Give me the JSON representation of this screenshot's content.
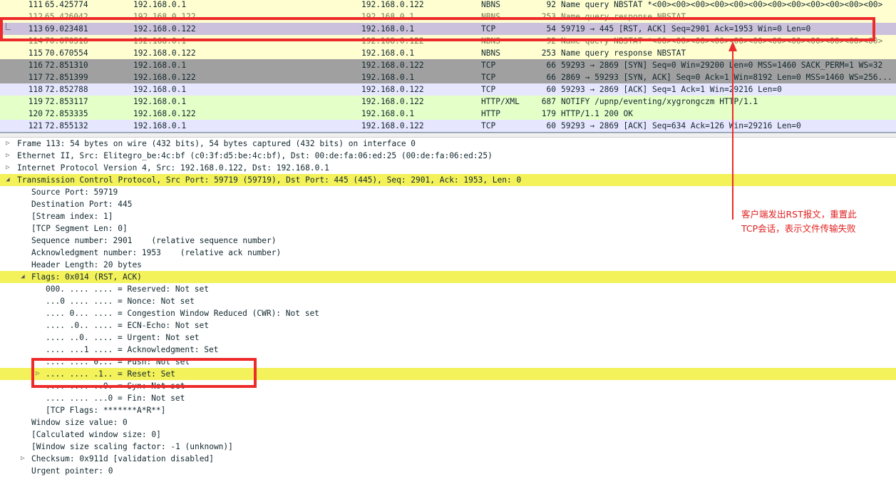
{
  "packet_list": {
    "rows": [
      {
        "no": "111",
        "time": "65.425774",
        "src": "192.168.0.1",
        "dst": "192.168.0.122",
        "proto": "NBNS",
        "len": "92",
        "info": "Name query NBSTAT *<00><00><00><00><00><00><00><00><00><00><00><00>"
      },
      {
        "no": "112",
        "time": "65.426042",
        "src": "192.168.0.122",
        "dst": "192.168.0.1",
        "proto": "NBNS",
        "len": "253",
        "info": "Name query response NBSTAT"
      },
      {
        "no": "113",
        "time": "69.023481",
        "src": "192.168.0.122",
        "dst": "192.168.0.1",
        "proto": "TCP",
        "len": "54",
        "info": "59719 → 445 [RST, ACK] Seq=2901 Ack=1953 Win=0 Len=0"
      },
      {
        "no": "114",
        "time": "70.670518",
        "src": "192.168.0.1",
        "dst": "192.168.0.122",
        "proto": "NBNS",
        "len": "92",
        "info": "Name query NBSTAT *<00><00><00><00><00><00><00><00><00><00><00><00>"
      },
      {
        "no": "115",
        "time": "70.670554",
        "src": "192.168.0.122",
        "dst": "192.168.0.1",
        "proto": "NBNS",
        "len": "253",
        "info": "Name query response NBSTAT"
      },
      {
        "no": "116",
        "time": "72.851310",
        "src": "192.168.0.1",
        "dst": "192.168.0.122",
        "proto": "TCP",
        "len": "66",
        "info": "59293 → 2869 [SYN] Seq=0 Win=29200 Len=0 MSS=1460 SACK_PERM=1 WS=32"
      },
      {
        "no": "117",
        "time": "72.851399",
        "src": "192.168.0.122",
        "dst": "192.168.0.1",
        "proto": "TCP",
        "len": "66",
        "info": "2869 → 59293 [SYN, ACK] Seq=0 Ack=1 Win=8192 Len=0 MSS=1460 WS=256..."
      },
      {
        "no": "118",
        "time": "72.852788",
        "src": "192.168.0.1",
        "dst": "192.168.0.122",
        "proto": "TCP",
        "len": "60",
        "info": "59293 → 2869 [ACK] Seq=1 Ack=1 Win=29216 Len=0"
      },
      {
        "no": "119",
        "time": "72.853117",
        "src": "192.168.0.1",
        "dst": "192.168.0.122",
        "proto": "HTTP/XML",
        "len": "687",
        "info": "NOTIFY /upnp/eventing/xygrongczm HTTP/1.1"
      },
      {
        "no": "120",
        "time": "72.853335",
        "src": "192.168.0.122",
        "dst": "192.168.0.1",
        "proto": "HTTP",
        "len": "179",
        "info": "HTTP/1.1 200 OK"
      },
      {
        "no": "121",
        "time": "72.855132",
        "src": "192.168.0.1",
        "dst": "192.168.0.122",
        "proto": "TCP",
        "len": "60",
        "info": "59293 → 2869 [ACK] Seq=634 Ack=126 Win=29216 Len=0"
      }
    ]
  },
  "details": {
    "lines": [
      {
        "text": "Frame 113: 54 bytes on wire (432 bits), 54 bytes captured (432 bits) on interface 0",
        "expander": "▷"
      },
      {
        "text": "Ethernet II, Src: Elitegro_be:4c:bf (c0:3f:d5:be:4c:bf), Dst: 00:de:fa:06:ed:25 (00:de:fa:06:ed:25)",
        "expander": "▷"
      },
      {
        "text": "Internet Protocol Version 4, Src: 192.168.0.122, Dst: 192.168.0.1",
        "expander": "▷"
      },
      {
        "text": "Transmission Control Protocol, Src Port: 59719 (59719), Dst Port: 445 (445), Seq: 2901, Ack: 1953, Len: 0",
        "expander": "◢"
      },
      {
        "text": "Source Port: 59719"
      },
      {
        "text": "Destination Port: 445"
      },
      {
        "text": "[Stream index: 1]"
      },
      {
        "text": "[TCP Segment Len: 0]"
      },
      {
        "text": "Sequence number: 2901    (relative sequence number)"
      },
      {
        "text": "Acknowledgment number: 1953    (relative ack number)"
      },
      {
        "text": "Header Length: 20 bytes"
      },
      {
        "text": "Flags: 0x014 (RST, ACK)",
        "expander": "◢"
      },
      {
        "text": "000. .... .... = Reserved: Not set"
      },
      {
        "text": "...0 .... .... = Nonce: Not set"
      },
      {
        "text": ".... 0... .... = Congestion Window Reduced (CWR): Not set"
      },
      {
        "text": ".... .0.. .... = ECN-Echo: Not set"
      },
      {
        "text": ".... ..0. .... = Urgent: Not set"
      },
      {
        "text": ".... ...1 .... = Acknowledgment: Set"
      },
      {
        "text": ".... .... 0... = Push: Not set"
      },
      {
        "text": ".... .... .1.. = Reset: Set",
        "expander": "▷"
      },
      {
        "text": ".... .... ..0. = Syn: Not set"
      },
      {
        "text": ".... .... ...0 = Fin: Not set"
      },
      {
        "text": "[TCP Flags: *******A*R**]"
      },
      {
        "text": "Window size value: 0"
      },
      {
        "text": "[Calculated window size: 0]"
      },
      {
        "text": "[Window size scaling factor: -1 (unknown)]"
      },
      {
        "text": "Checksum: 0x911d [validation disabled]",
        "expander": "▷"
      },
      {
        "text": "Urgent pointer: 0"
      }
    ]
  },
  "annotation": {
    "text": "客户端发出RST报文，重置此\nTCP会话，表示文件传输失败",
    "color": "#e02020"
  },
  "colors": {
    "highlight": "#f3f25a",
    "annotation_box": "#ee2b2b",
    "nbns_row": "#fefed0",
    "tcp_row": "#e7e6ff",
    "syn_row": "#a0a0a0",
    "http_row": "#e4ffc7",
    "selected_row": "#cbc1dd"
  }
}
